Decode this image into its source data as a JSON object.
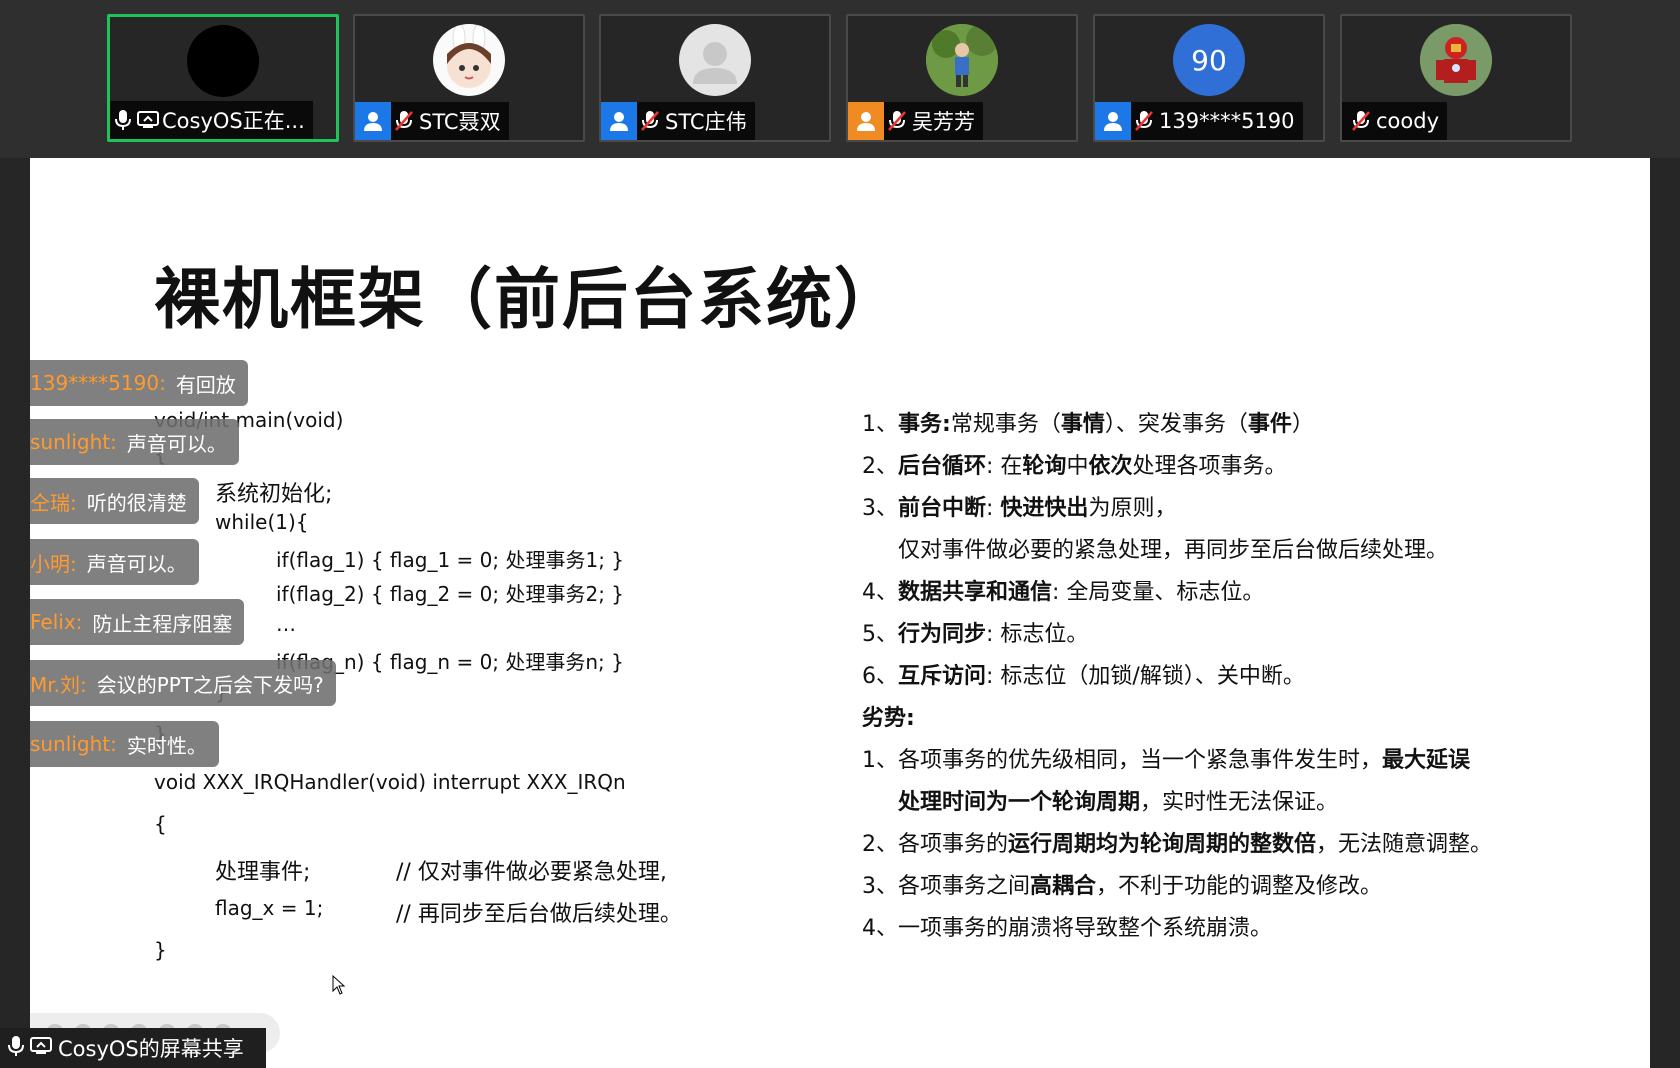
{
  "participants": [
    {
      "name": "CosyOS正在...",
      "role": "none",
      "avatar": "black",
      "mic": "on",
      "sharing": true,
      "active": true
    },
    {
      "name": "STC聂双",
      "role": "blue",
      "avatar": "bunny",
      "mic": "muted",
      "sharing": false,
      "active": false
    },
    {
      "name": "STC庄伟",
      "role": "blue",
      "avatar": "default",
      "mic": "muted",
      "sharing": false,
      "active": false
    },
    {
      "name": "吴芳芳",
      "role": "orange",
      "avatar": "child-photo",
      "mic": "muted",
      "sharing": false,
      "active": false
    },
    {
      "name": "139****5190",
      "role": "blue",
      "avatar": "90",
      "mic": "muted",
      "sharing": false,
      "active": false
    },
    {
      "name": "coody",
      "role": "none",
      "avatar": "ironman",
      "mic": "muted",
      "sharing": false,
      "active": false
    }
  ],
  "slide": {
    "title": "裸机框架（前后台系统）",
    "code_main": [
      "void/int main(void)",
      "{",
      "系统初始化;",
      "while(1){",
      "if(flag_1) { flag_1 = 0; 处理事务1; }",
      "if(flag_2) { flag_2 = 0; 处理事务2; }",
      "…",
      "if(flag_n) { flag_n = 0; 处理事务n; }",
      "}",
      "}"
    ],
    "code_isr": [
      "void XXX_IRQHandler(void) interrupt XXX_IRQn",
      "{",
      "处理事件;",
      "// 仅对事件做必要紧急处理,",
      "flag_x = 1;",
      "// 再同步至后台做后续处理。",
      "}"
    ],
    "points": [
      {
        "num": "1、",
        "bold": "事务:",
        "text": "常规事务（",
        "b2": "事情",
        "t2": "）、突发事务（",
        "b3": "事件",
        "t3": "）"
      },
      {
        "num": "2、",
        "bold": "后台循环",
        "text": ": 在",
        "b2": "轮询",
        "t2": "中",
        "b3": "依次",
        "t3": "处理各项事务。"
      },
      {
        "num": "3、",
        "bold": "前台中断",
        "text": ": ",
        "b2": "快进快出",
        "t2": "为原则，",
        "b3": "",
        "t3": ""
      },
      {
        "num": "",
        "bold": "",
        "text": "仅对事件做必要的紧急处理，再同步至后台做后续处理。",
        "b2": "",
        "t2": "",
        "b3": "",
        "t3": ""
      },
      {
        "num": "4、",
        "bold": "数据共享和通信",
        "text": ": 全局变量、标志位。",
        "b2": "",
        "t2": "",
        "b3": "",
        "t3": ""
      },
      {
        "num": "5、",
        "bold": "行为同步",
        "text": ": 标志位。",
        "b2": "",
        "t2": "",
        "b3": "",
        "t3": ""
      },
      {
        "num": "6、",
        "bold": "互斥访问",
        "text": ": 标志位（加锁/解锁）、关中断。",
        "b2": "",
        "t2": "",
        "b3": "",
        "t3": ""
      }
    ],
    "disadv_title": "劣势:",
    "disadv": [
      {
        "num": "1、",
        "text": "各项事务的优先级相同，当一个紧急事件发生时，",
        "bold": "最大延误",
        "t2": ""
      },
      {
        "num": "",
        "text": "",
        "bold": "处理时间为一个轮询周期",
        "t2": "，实时性无法保证。"
      },
      {
        "num": "2、",
        "text": "各项事务的",
        "bold": "运行周期均为轮询周期的整数倍",
        "t2": "，无法随意调整。"
      },
      {
        "num": "3、",
        "text": "各项事务之间",
        "bold": "高耦合",
        "t2": "，不利于功能的调整及修改。"
      },
      {
        "num": "4、",
        "text": "一项事务的崩溃将导致整个系统崩溃。",
        "bold": "",
        "t2": ""
      }
    ]
  },
  "chat": [
    {
      "sender": "139****5190:",
      "msg": "有回放"
    },
    {
      "sender": "sunlight:",
      "msg": "声音可以。"
    },
    {
      "sender": "仝瑞:",
      "msg": "听的很清楚"
    },
    {
      "sender": "小明:",
      "msg": "声音可以。"
    },
    {
      "sender": "Felix:",
      "msg": "防止主程序阻塞"
    },
    {
      "sender": "Mr.刘:",
      "msg": "会议的PPT之后会下发吗?"
    },
    {
      "sender": "sunlight:",
      "msg": "实时性。"
    }
  ],
  "share_status": "CosyOS的屏幕共享",
  "colors": {
    "active_border": "#1ec35a",
    "host_blue": "#1b78e6",
    "cohost_orange": "#f08a22",
    "chat_sender": "#ff9a2e",
    "avatar_90": "#2f6fd6"
  }
}
